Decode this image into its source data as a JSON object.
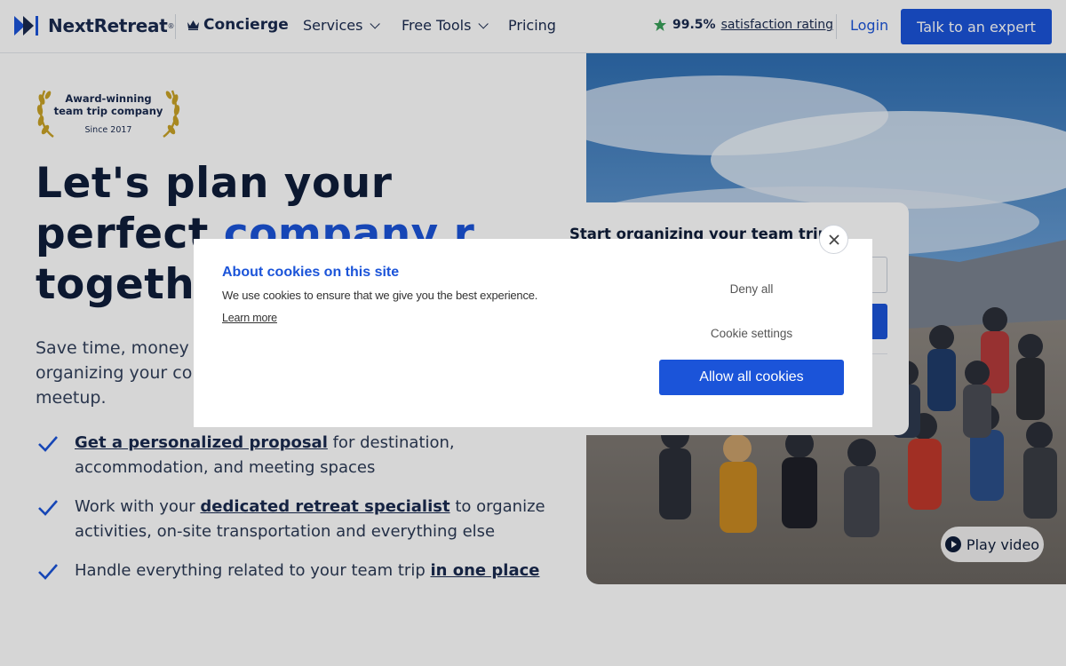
{
  "header": {
    "logo_text": "NextRetreat",
    "logo_reg": "®",
    "concierge_label": "Concierge",
    "nav": [
      {
        "label": "Services"
      },
      {
        "label": "Free Tools"
      },
      {
        "label": "Pricing"
      }
    ],
    "rating_value": "99.5%",
    "rating_text": "satisfaction rating",
    "login_label": "Login",
    "cta_label": "Talk to an expert"
  },
  "badge": {
    "line1": "Award-winning",
    "line2": "team trip company",
    "since": "Since 2017"
  },
  "hero": {
    "title_line1": "Let's plan your",
    "title_line2_start": "perfect ",
    "title_line2_accent": "company r",
    "title_line3": "togeth",
    "subtitle_line1": "Save time, money",
    "subtitle_line2": "organizing your co",
    "subtitle_line3": "meetup."
  },
  "bullets": [
    {
      "link": "Get a personalized proposal",
      "after": " for destination, accommodation, and meeting spaces"
    },
    {
      "before": "Work with your ",
      "link": "dedicated retreat specialist",
      "after": " to organize activities, on-site transportation and everything else"
    },
    {
      "before": "Handle everything related to your team trip ",
      "link": "in one place"
    }
  ],
  "form": {
    "title": "Start organizing your team trip"
  },
  "video": {
    "play_label": "Play video"
  },
  "cookie_modal": {
    "title": "About cookies on this site",
    "body": "We use cookies to ensure that we give you the best experience.",
    "learn_more": "Learn more",
    "deny_label": "Deny all",
    "settings_label": "Cookie settings",
    "allow_label": "Allow all cookies"
  },
  "colors": {
    "accent": "#1b54d9",
    "heading": "#0f1d3a",
    "badge_gold": "#c9a227",
    "star": "#3aa05a"
  }
}
